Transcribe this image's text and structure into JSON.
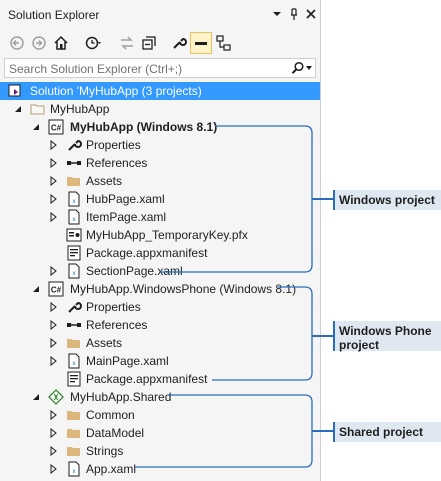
{
  "window": {
    "title": "Solution Explorer",
    "controls": [
      "dropdown-arrow-icon",
      "pin-icon",
      "close-icon"
    ]
  },
  "toolbar": {
    "tools": [
      "back-icon",
      "forward-icon",
      "home-icon",
      "history-icon",
      "sync-icon",
      "collapse-all-icon",
      "properties-icon",
      "show-all-files-icon",
      "view-class-diagram-icon"
    ]
  },
  "search": {
    "placeholder": "Search Solution Explorer (Ctrl+;)",
    "icon": "search-icon"
  },
  "tree": {
    "solution": "Solution 'MyHubApp (3 projects)",
    "folder": "MyHubApp",
    "windows_project": {
      "name": "MyHubApp (Windows 8.1)",
      "items": [
        "Properties",
        "References",
        "Assets",
        "HubPage.xaml",
        "ItemPage.xaml",
        "MyHubApp_TemporaryKey.pfx",
        "Package.appxmanifest",
        "SectionPage.xaml"
      ]
    },
    "phone_project": {
      "name": "MyHubApp.WindowsPhone (Windows 8.1)",
      "items": [
        "Properties",
        "References",
        "Assets",
        "MainPage.xaml",
        "Package.appxmanifest"
      ]
    },
    "shared_project": {
      "name": "MyHubApp.Shared",
      "items": [
        "Common",
        "DataModel",
        "Strings",
        "App.xaml"
      ]
    }
  },
  "callouts": {
    "windows": "Windows project",
    "phone": "Windows Phone project",
    "shared": "Shared project"
  },
  "colors": {
    "selection": "#3399ff",
    "accent": "#2a6ebb",
    "callout_bg": "#dfe7f1"
  }
}
